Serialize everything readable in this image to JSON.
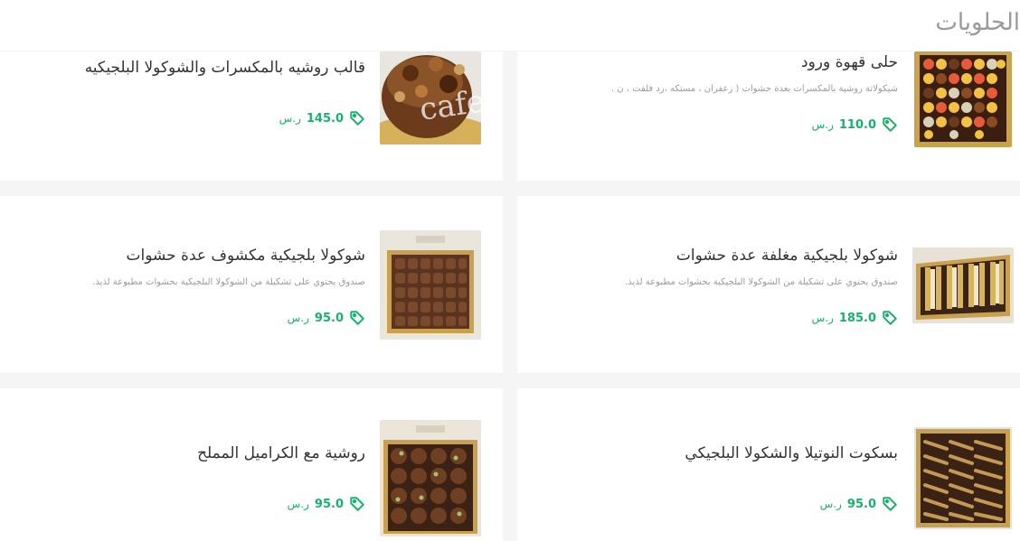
{
  "section": {
    "title": "الحلويات"
  },
  "currency": "ر.س",
  "colors": {
    "price": "#17b36b",
    "title": "#333333",
    "description": "#9b9b9b"
  },
  "icons": {
    "price": "tag-icon"
  },
  "items": [
    {
      "title": "قالب روشيه بالمكسرات والشوكولا البلجيكيه",
      "description": "",
      "price": "145.0",
      "image_text": "cafe"
    },
    {
      "title": "حلى قهوة ورود",
      "description": "شيكولاتة روشية بالمكسرات بعدة حشوات ( زعفران ، مستكه ،رد فلفت ، ن .",
      "price": "110.0"
    },
    {
      "title": "شوكولا بلجيكية مكشوف عدة حشوات",
      "description": "صندوق يحتوي على تشكيلة من الشوكولا البلجيكية بحشوات مطبوعة لذيذ.",
      "price": "95.0"
    },
    {
      "title": "شوكولا بلجيكية مغلفة عدة حشوات",
      "description": "صندوق يحتوي على تشكيلة من الشوكولا البلجيكية بحشوات مطبوعة لذيذ.",
      "price": "185.0"
    },
    {
      "title": "روشية مع الكراميل المملح",
      "description": "",
      "price": "95.0"
    },
    {
      "title": "بسكوت النوتيلا والشكولا البلجيكي",
      "description": "",
      "price": "95.0"
    }
  ]
}
